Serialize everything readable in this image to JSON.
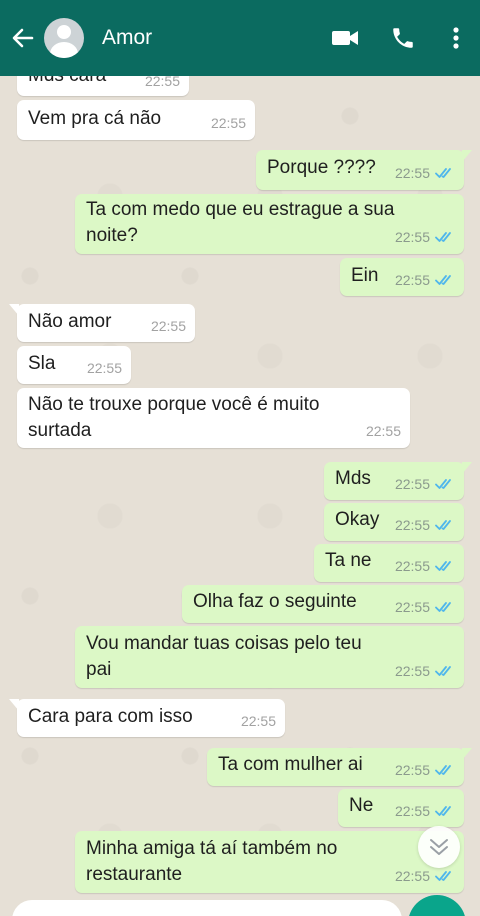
{
  "header": {
    "title": "Amor",
    "colors": {
      "bar": "#0b6b60",
      "bubble_out": "#dcf8c6",
      "bubble_in": "#ffffff",
      "read_ticks": "#4fb6ec"
    },
    "icons": [
      "back-arrow-icon",
      "avatar",
      "video-call-icon",
      "phone-icon",
      "more-options-icon"
    ]
  },
  "messages": [
    {
      "text": "Mds cara",
      "time": "22:55",
      "dir": "in"
    },
    {
      "text": "Vem pra cá não",
      "time": "22:55",
      "dir": "in"
    },
    {
      "text": "Porque ????",
      "time": "22:55",
      "dir": "out"
    },
    {
      "text_line1": "Ta com medo que eu estrague a sua",
      "text_line2": "noite?",
      "time": "22:55",
      "dir": "out"
    },
    {
      "text": "Ein",
      "time": "22:55",
      "dir": "out"
    },
    {
      "text": "Não amor",
      "time": "22:55",
      "dir": "in"
    },
    {
      "text": "Sla",
      "time": "22:55",
      "dir": "in"
    },
    {
      "text_line1": "Não te trouxe porque você é muito",
      "text_line2": "surtada",
      "time": "22:55",
      "dir": "in"
    },
    {
      "text": "Mds",
      "time": "22:55",
      "dir": "out"
    },
    {
      "text": "Okay",
      "time": "22:55",
      "dir": "out"
    },
    {
      "text": "Ta ne",
      "time": "22:55",
      "dir": "out"
    },
    {
      "text": "Olha faz o seguinte",
      "time": "22:55",
      "dir": "out"
    },
    {
      "text_line1": "Vou mandar tuas coisas pelo teu",
      "text_line2": "pai",
      "time": "22:55",
      "dir": "out"
    },
    {
      "text": "Cara para com isso",
      "time": "22:55",
      "dir": "in"
    },
    {
      "text": "Ta com mulher ai",
      "time": "22:55",
      "dir": "out"
    },
    {
      "text": "Ne",
      "time": "22:55",
      "dir": "out"
    },
    {
      "text_line1": "Minha amiga tá aí também no",
      "text_line2": "restaurante",
      "time": "22:55",
      "dir": "out"
    }
  ]
}
